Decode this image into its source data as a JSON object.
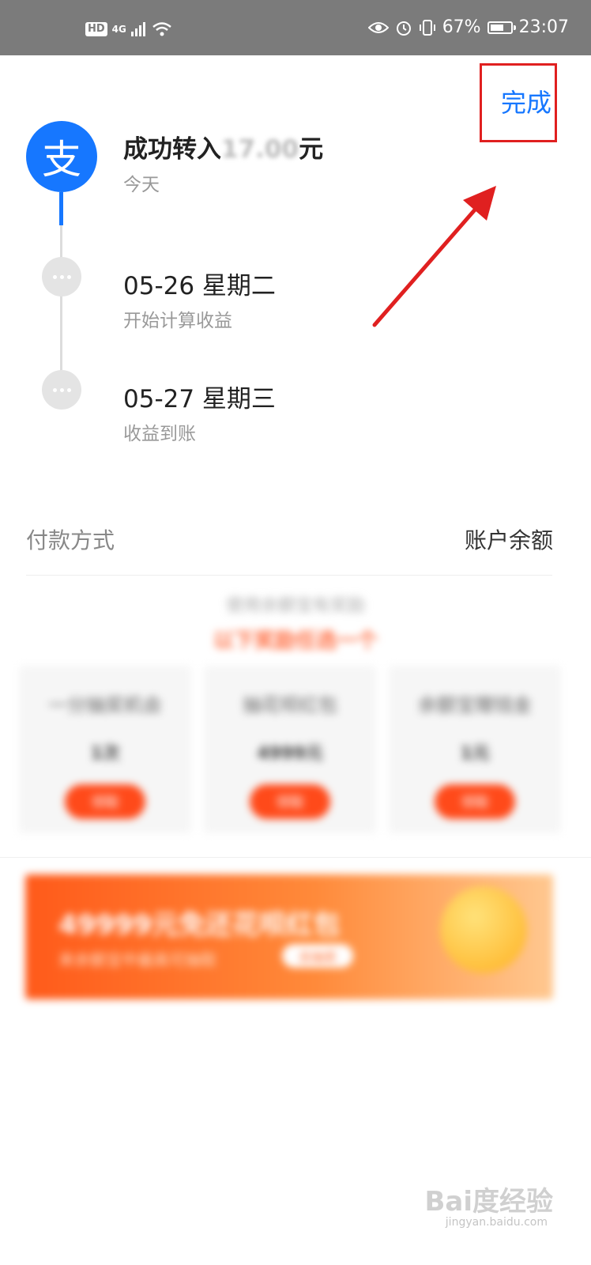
{
  "status_bar": {
    "hd": "HD",
    "network": "4G",
    "battery_percent": "67%",
    "battery_level": 0.67,
    "time": "23:07"
  },
  "header": {
    "done_label": "完成"
  },
  "timeline": {
    "success": {
      "title_prefix": "成功转入",
      "amount": "17.00",
      "unit": "元",
      "date": "今天"
    },
    "step1": {
      "title": "05-26 星期二",
      "desc": "开始计算收益"
    },
    "step2": {
      "title": "05-27 星期三",
      "desc": "收益到账"
    }
  },
  "payment": {
    "label": "付款方式",
    "value": "账户余额"
  },
  "rewards": {
    "hint": "使用余额宝有奖励",
    "title": "以下奖励任选一个",
    "cards": [
      {
        "name": "一分抽奖机会",
        "value": "1次",
        "button": "领取"
      },
      {
        "name": "抽花呗红包",
        "value": "4999元",
        "button": "领取"
      },
      {
        "name": "余额宝赠钱金",
        "value": "1元",
        "button": "领取"
      }
    ]
  },
  "banner": {
    "title": "49999元免还花呗红包",
    "subtitle": "来余额宝中最高可抽取",
    "button": "去抽奖"
  },
  "watermark": {
    "text": "Bai度经验",
    "sub": "jingyan.baidu.com"
  },
  "colors": {
    "accent": "#1677ff",
    "highlight": "#e02020",
    "orange": "#ff5a1a"
  }
}
